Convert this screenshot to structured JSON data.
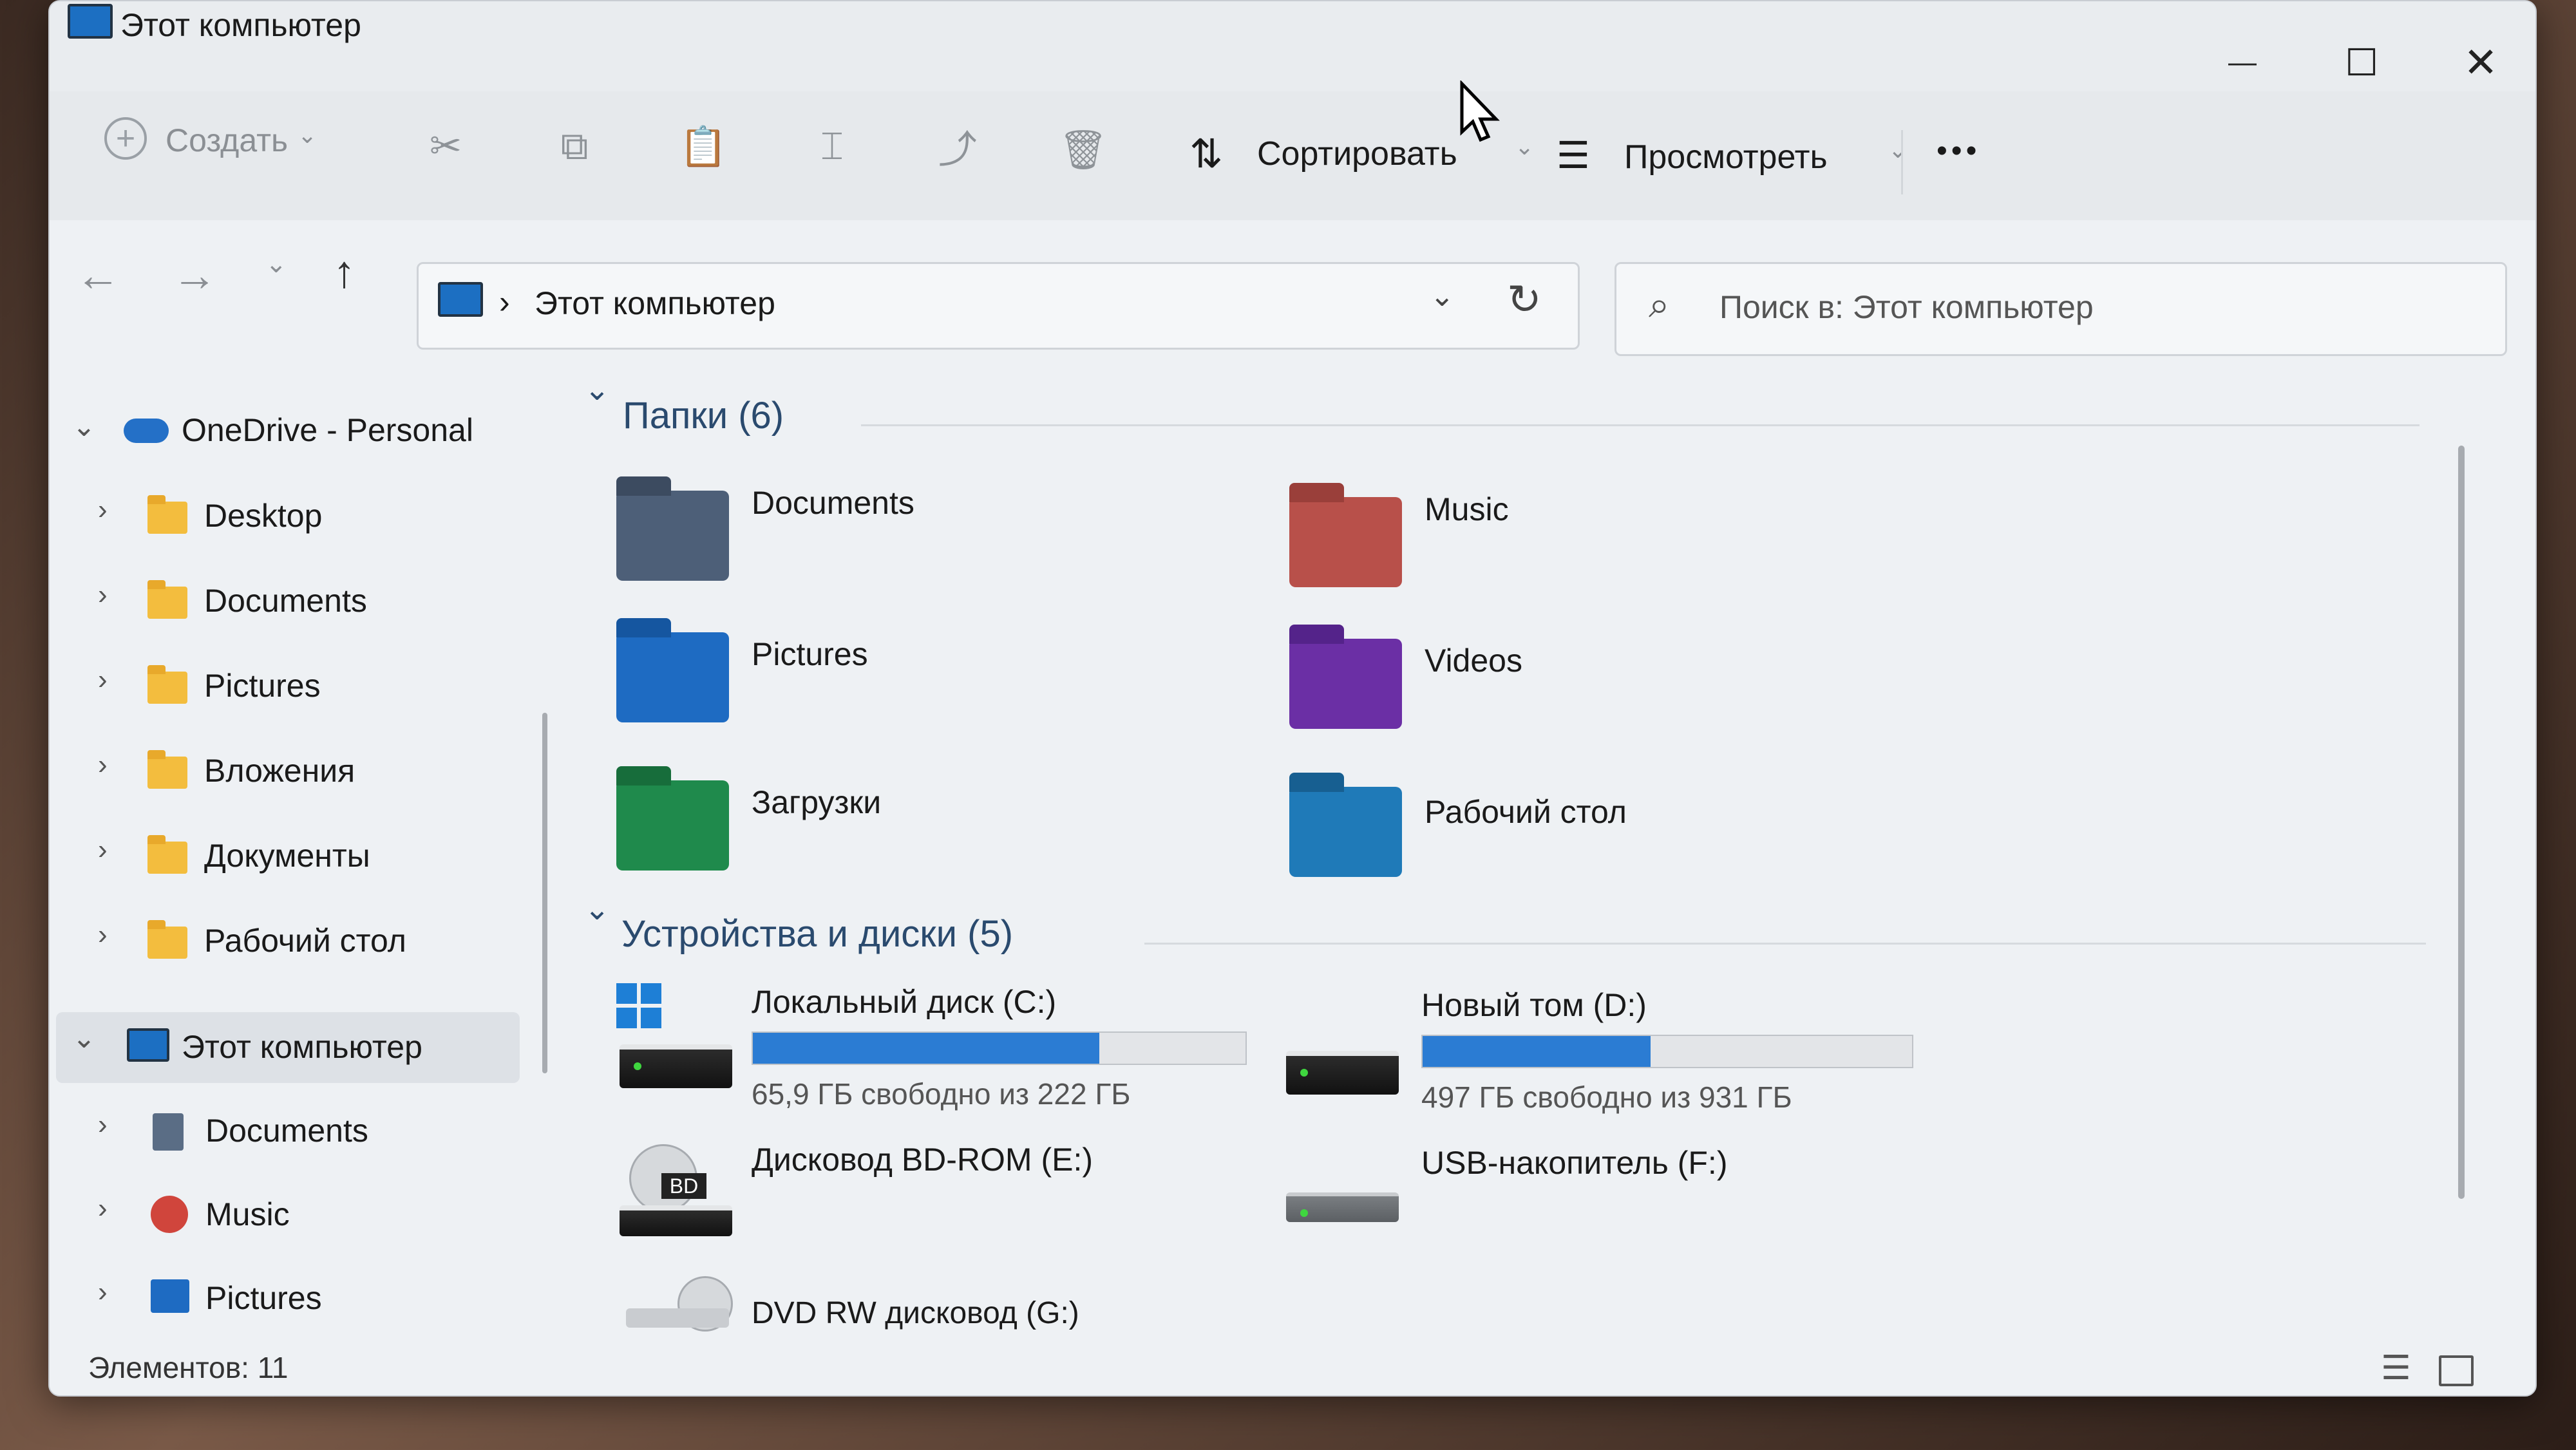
{
  "window": {
    "title": "Этот компьютер",
    "controls": {
      "minimize": "—",
      "maximize": "☐",
      "close": "✕"
    }
  },
  "toolbar": {
    "new_label": "Создать",
    "sort_label": "Сортировать",
    "view_label": "Просмотреть",
    "more_label": "•••"
  },
  "address": {
    "path": "Этот компьютер",
    "separator": "›",
    "search_placeholder": "Поиск в: Этот компьютер"
  },
  "nav": {
    "onedrive": {
      "label": "OneDrive - Personal",
      "children": [
        "Desktop",
        "Documents",
        "Pictures",
        "Вложения",
        "Документы",
        "Рабочий стол"
      ]
    },
    "thispc": {
      "label": "Этот компьютер",
      "children": [
        "Documents",
        "Music",
        "Pictures"
      ]
    }
  },
  "content": {
    "folders_header": "Папки (6)",
    "folders": [
      {
        "name": "Documents",
        "icon": "documents-folder-icon",
        "color": "#4d5f78"
      },
      {
        "name": "Music",
        "icon": "music-folder-icon",
        "color": "#c0504d"
      },
      {
        "name": "Pictures",
        "icon": "pictures-folder-icon",
        "color": "#1e6bc2"
      },
      {
        "name": "Videos",
        "icon": "videos-folder-icon",
        "color": "#6b2fa5"
      },
      {
        "name": "Загрузки",
        "icon": "downloads-folder-icon",
        "color": "#1f8a4c"
      },
      {
        "name": "Рабочий стол",
        "icon": "desktop-folder-icon",
        "color": "#1f7ab8"
      }
    ],
    "devices_header": "Устройства и диски (5)",
    "drives": [
      {
        "name": "Локальный диск (C:)",
        "free": "65,9 ГБ свободно из 222 ГБ",
        "used_fraction": 0.703
      },
      {
        "name": "Новый том (D:)",
        "free": "497 ГБ свободно из 931 ГБ",
        "used_fraction": 0.466
      },
      {
        "name": "Дисковод BD-ROM (E:)"
      },
      {
        "name": "USB-накопитель (F:)"
      },
      {
        "name": "DVD RW дисковод (G:)"
      }
    ]
  },
  "status": {
    "items": "Элементов: 11"
  },
  "colors": {
    "accent": "#2b7cd3",
    "folder_yellow": "#f3bd3e",
    "header_blue": "#2a4a6e"
  }
}
